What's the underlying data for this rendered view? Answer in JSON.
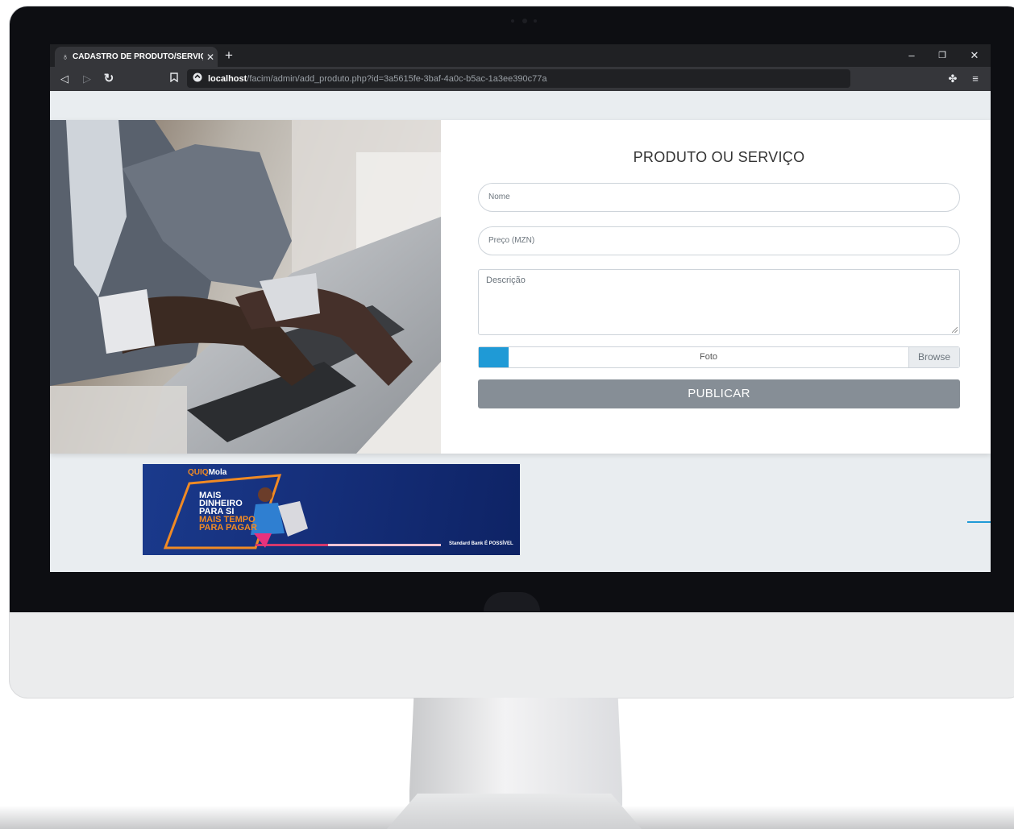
{
  "browser": {
    "tab_title": "CADASTRO DE PRODUTO/SERVIÇ",
    "new_tab": "+",
    "window_controls": {
      "minimize": "–",
      "restore": "❐",
      "close": "✕"
    },
    "url_host": "localhost",
    "url_path": "/facim/admin/add_produto.php?id=3a5615fe-3baf-4a0c-b5ac-1a3ee390c77a"
  },
  "form": {
    "title": "PRODUTO OU SERVIÇO",
    "nome_placeholder": "Nome",
    "preco_placeholder": "Preço (MZN)",
    "descricao_placeholder": "Descrição",
    "foto_label": "Foto",
    "browse_label": "Browse",
    "submit_label": "PUBLICAR"
  },
  "banner": {
    "brand_prefix": "QUIQ",
    "brand_suffix": "Mola",
    "line1": "MAIS",
    "line2": "DINHEIRO",
    "line3": "PARA SI",
    "line4": "MAIS TEMPO",
    "line5": "PARA PAGAR",
    "footer": "Standard Bank É POSSÍVEL"
  },
  "colors": {
    "accent": "#1f9ad6",
    "button": "#868e96",
    "chrome_dark": "#202124"
  }
}
